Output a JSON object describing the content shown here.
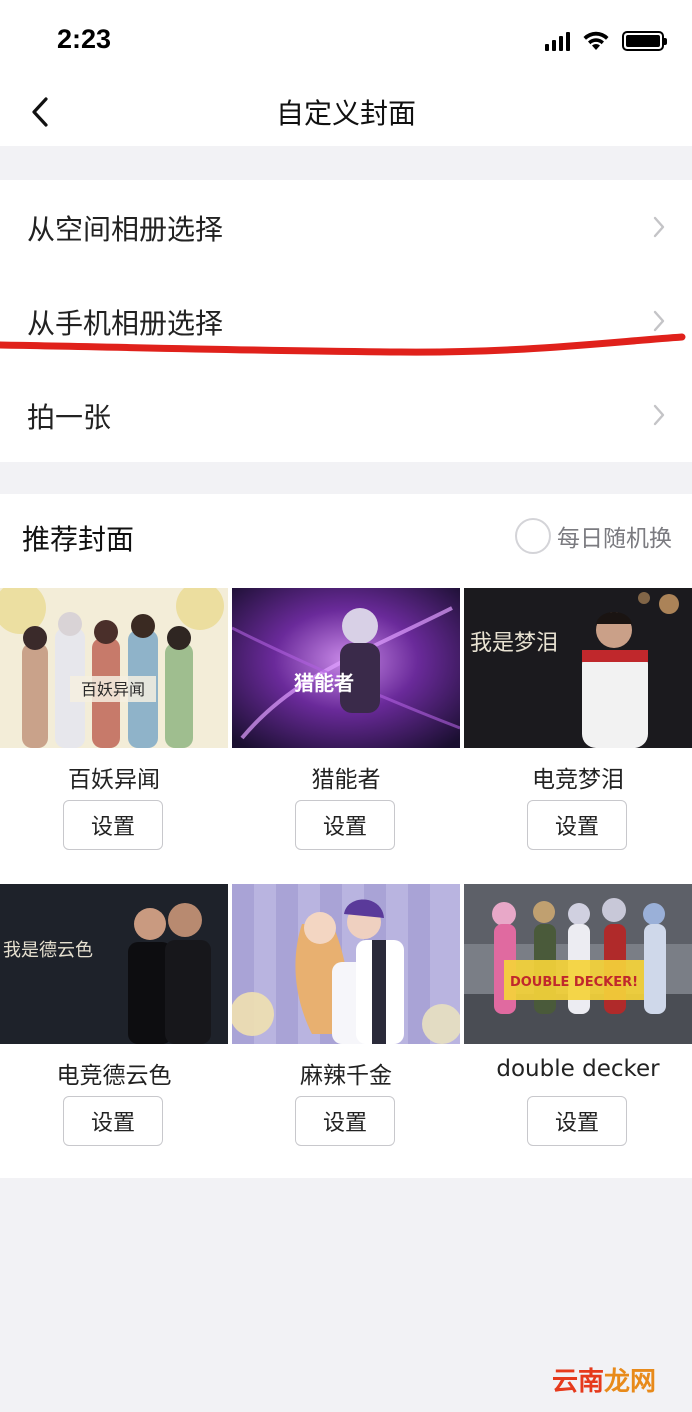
{
  "status_bar": {
    "time": "2:23"
  },
  "nav": {
    "title": "自定义封面",
    "back_icon": "chevron-left-icon"
  },
  "menu": [
    {
      "label": "从空间相册选择"
    },
    {
      "label": "从手机相册选择"
    },
    {
      "label": "拍一张"
    }
  ],
  "recommend": {
    "title": "推荐封面",
    "daily_random_label": "每日随机换",
    "set_label": "设置",
    "covers": [
      {
        "name": "百妖异闻",
        "thumb_text": "百妖异闻"
      },
      {
        "name": "猎能者",
        "thumb_text": "猎能者"
      },
      {
        "name": "电竞梦泪",
        "thumb_text": "我是梦泪"
      },
      {
        "name": "电竞德云色",
        "thumb_text": "我是德云色"
      },
      {
        "name": "麻辣千金",
        "thumb_text": ""
      },
      {
        "name": "double decker",
        "thumb_text": "DOUBLE DECKER!"
      }
    ]
  },
  "watermark": {
    "part1": "云南",
    "part2": "龙网"
  },
  "colors": {
    "annotation_line": "#e0211b",
    "background": "#f2f2f5",
    "chevron": "#c4c4c7"
  }
}
